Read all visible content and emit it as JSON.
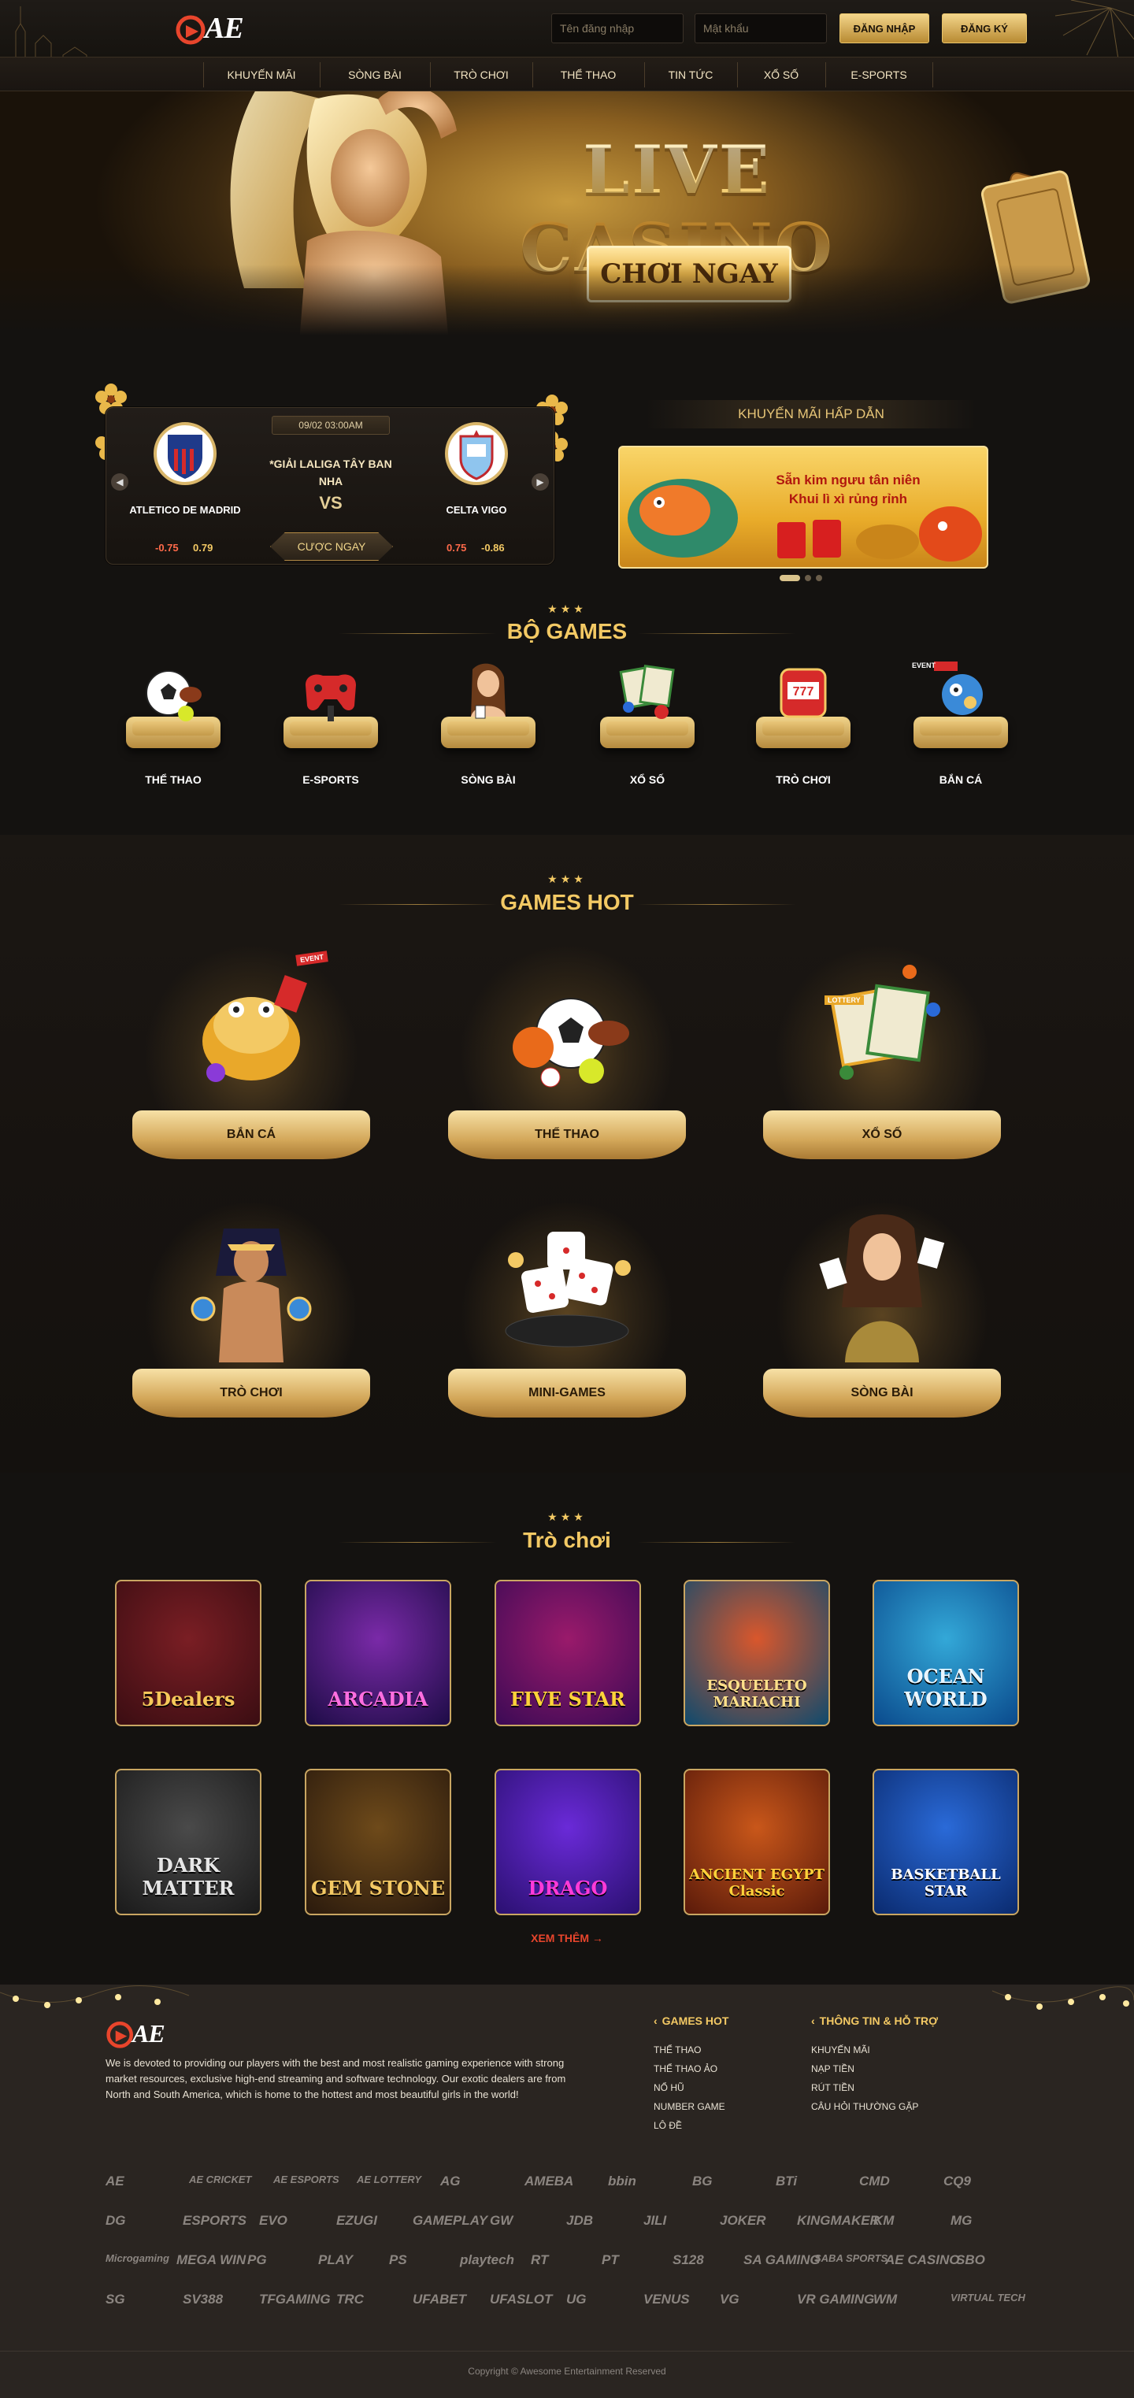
{
  "header": {
    "logo": "AE",
    "username_placeholder": "Tên đăng nhập",
    "password_placeholder": "Mật khẩu",
    "login_label": "ĐĂNG NHẬP",
    "register_label": "ĐĂNG KÝ"
  },
  "nav": {
    "items": [
      "KHUYẾN MÃI",
      "SÒNG BÀI",
      "TRÒ CHƠI",
      "THỂ THAO",
      "TIN TỨC",
      "XỔ SỐ",
      "E-SPORTS"
    ]
  },
  "hero": {
    "title": "LIVE CASINO",
    "cta": "CHƠI NGAY"
  },
  "match": {
    "date": "09/02 03:00AM",
    "league": "*GIẢI LALIGA TÂY BAN NHA",
    "vs": "VS",
    "home": "ATLETICO DE MADRID",
    "away": "CELTA VIGO",
    "home_odds": [
      "-0.75",
      "0.79"
    ],
    "away_odds": [
      "0.75",
      "-0.86"
    ],
    "bet_label": "CƯỢC NGAY"
  },
  "promo": {
    "title": "KHUYẾN MÃI HẤP DẪN",
    "banner_line1": "Sẵn kim ngưu tân niên",
    "banner_line2": "Khui lì xì rủng rỉnh"
  },
  "bo_games": {
    "title": "BỘ GAMES",
    "items": [
      "THỂ THAO",
      "E-SPORTS",
      "SÒNG BÀI",
      "XỔ SỐ",
      "TRÒ CHƠI",
      "BẮN CÁ"
    ],
    "event_badge": "EVENT"
  },
  "games_hot": {
    "title": "GAMES HOT",
    "items": [
      "BẮN CÁ",
      "THỂ THAO",
      "XỔ SỐ",
      "TRÒ CHƠI",
      "MINI-GAMES",
      "SÒNG BÀI"
    ],
    "event_badge": "EVENT",
    "lottery_label": "LOTTERY"
  },
  "tro_choi": {
    "title": "Trò chơi",
    "slots": [
      {
        "name": "5Dealers",
        "colors": [
          "#3a0d12",
          "#7a1e24"
        ],
        "text_color": "#f6c85a"
      },
      {
        "name": "ARCADIA",
        "colors": [
          "#1d0c46",
          "#7a2aa8"
        ],
        "text_color": "#ff6ee0"
      },
      {
        "name": "FIVE STAR",
        "colors": [
          "#3b0a55",
          "#9a1a6b"
        ],
        "text_color": "#ffd23a"
      },
      {
        "name": "ESQUELETO MARIACHI",
        "colors": [
          "#0d4a6e",
          "#d9572c"
        ],
        "text_color": "#ffe08a"
      },
      {
        "name": "OCEAN WORLD",
        "colors": [
          "#0a4a8c",
          "#33a8d8"
        ],
        "text_color": "#e9f6ff"
      },
      {
        "name": "DARK MATTER",
        "colors": [
          "#1a1a1a",
          "#4a4a4a"
        ],
        "text_color": "#e6e6e6"
      },
      {
        "name": "GEM STONE",
        "colors": [
          "#2a1a0d",
          "#6e4a1a"
        ],
        "text_color": "#f3c964"
      },
      {
        "name": "DRAGO",
        "colors": [
          "#2a1070",
          "#6a2ad8"
        ],
        "text_color": "#ff3ad8"
      },
      {
        "name": "ANCIENT EGYPT Classic",
        "colors": [
          "#5a1a0a",
          "#c9571a"
        ],
        "text_color": "#ffd23a"
      },
      {
        "name": "BASKETBALL STAR",
        "colors": [
          "#0a2a6e",
          "#2a6ad8"
        ],
        "text_color": "#ffffff"
      }
    ],
    "more_label": "XEM THÊM →"
  },
  "footer": {
    "description": "We is devoted to providing our players with the best and most realistic gaming experience with strong market resources, exclusive high-end streaming and software technology. Our exotic dealers are from North and South America, which is home to the hottest and most beautiful girls in the world!",
    "col1_title": "GAMES HOT",
    "col1_links": [
      "THỂ THAO",
      "THỂ THAO ẢO",
      "NỔ HŨ",
      "NUMBER GAME",
      "LÔ ĐỀ"
    ],
    "col2_title": "THÔNG TIN & HỖ TRỢ",
    "col2_links": [
      "KHUYẾN MÃI",
      "NẠP TIỀN",
      "RÚT TIỀN",
      "CÂU HỎI THƯỜNG GẶP"
    ],
    "providers": [
      [
        "AE",
        "AE CRICKET",
        "AE ESPORTS",
        "AE LOTTERY",
        "AG",
        "AMEBA",
        "bbin",
        "BG",
        "BTi",
        "CMD",
        "CQ9"
      ],
      [
        "DG",
        "ESPORTS",
        "EVO",
        "EZUGI",
        "GAMEPLAY",
        "GW",
        "JDB",
        "JILI",
        "JOKER",
        "KINGMAKER",
        "KM",
        "MG"
      ],
      [
        "Microgaming",
        "MEGA WIN",
        "PG",
        "PLAY",
        "PS",
        "playtech",
        "RT",
        "PT",
        "S128",
        "SA GAMING",
        "SABA SPORTS",
        "AE CASINO",
        "SBO"
      ],
      [
        "SG",
        "SV388",
        "TFGAMING",
        "TRC",
        "UFABET",
        "UFASLOT",
        "UG",
        "VENUS",
        "VG",
        "VR GAMING",
        "WM",
        "VIRTUAL TECH"
      ]
    ],
    "copyright": "Copyright © Awesome Entertainment Reserved"
  },
  "colors": {
    "accent_gold": "#f3c964",
    "background": "#141210",
    "footer_bg": "#2a2521",
    "cta_red": "#e8452c"
  }
}
